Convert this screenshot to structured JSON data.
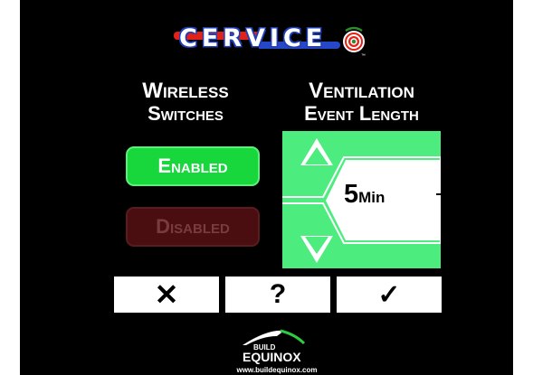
{
  "logo": {
    "text": "CERVICE",
    "trademark": "™"
  },
  "wireless": {
    "title": "Wireless",
    "subtitle": "Switches",
    "enabled_label": "Enabled",
    "disabled_label": "Disabled"
  },
  "ventilation": {
    "title": "Ventilation",
    "subtitle": "Event Length",
    "value": "5",
    "unit": "Min"
  },
  "buttons": {
    "cancel": "✕",
    "help": "?",
    "confirm": "✓"
  },
  "brand": {
    "line1": "BUILD",
    "line2": "EQUINOX",
    "url": "www.buildequinox.com"
  },
  "colors": {
    "background": "#000000",
    "enabled": "#17d73c",
    "disabled": "#4a0e10",
    "vent_panel": "#4cec7e",
    "logo_red": "#e32119",
    "logo_blue": "#2647c8"
  },
  "icons": {
    "up": "triangle-up-icon",
    "down": "triangle-down-icon",
    "wifi": "wifi-target-icon"
  }
}
